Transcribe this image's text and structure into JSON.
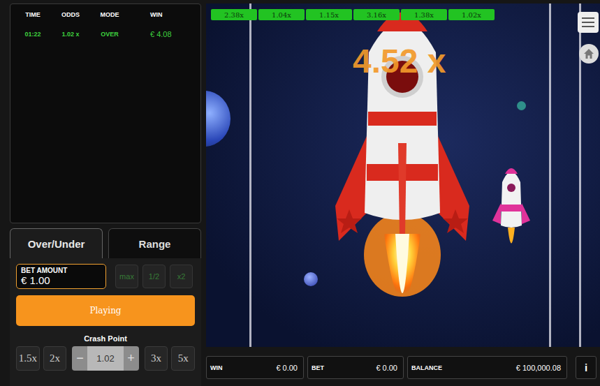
{
  "history": {
    "columns": [
      "TIME",
      "ODDS",
      "MODE",
      "WIN"
    ],
    "rows": [
      [
        "01:22",
        "1.02 x",
        "OVER",
        "€ 4.08"
      ]
    ]
  },
  "mode_tabs": [
    {
      "label": "Over/Under",
      "selected": true
    },
    {
      "label": "Range",
      "selected": false
    }
  ],
  "bet": {
    "label": "BET AMOUNT",
    "value": "€ 1.00",
    "quick_buttons": [
      {
        "label": "max",
        "disabled": true
      },
      {
        "label": "1/2",
        "disabled": true
      },
      {
        "label": "x2",
        "disabled": true
      }
    ]
  },
  "play_button": "Playing",
  "crash_point": {
    "label": "Crash Point",
    "presets_left": [
      "1.5x",
      "2x"
    ],
    "minus": "−",
    "value": "1.02",
    "plus": "+",
    "presets_right": [
      "3x",
      "5x"
    ]
  },
  "recent_multipliers": [
    "2.38x",
    "1.04x",
    "1.15x",
    "3.16x",
    "1.38x",
    "1.02x"
  ],
  "multiplier": "4.52 x",
  "footer": {
    "win": {
      "label": "WIN",
      "value": "€ 0.00"
    },
    "bet": {
      "label": "BET",
      "value": "€ 0.00"
    },
    "balance": {
      "label": "BALANCE",
      "value": "€ 100,000.08"
    },
    "info": "i"
  }
}
